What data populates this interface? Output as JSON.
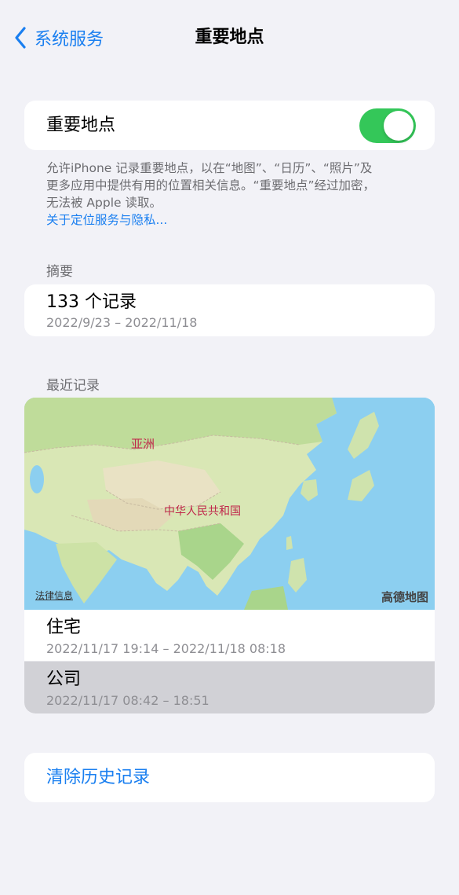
{
  "nav": {
    "back_label": "系统服务",
    "title": "重要地点"
  },
  "toggle": {
    "label": "重要地点",
    "on": true,
    "accent": "#34c759"
  },
  "footnote": {
    "line1": "允许iPhone 记录重要地点，以在“地图”、“日历”、“照片”及",
    "line2": "更多应用中提供有用的位置相关信息。“重要地点”经过加密，",
    "line3": "无法被 Apple 读取。",
    "link": "关于定位服务与隐私..."
  },
  "summary": {
    "header": "摘要",
    "count": "133 个记录",
    "range": "2022/9/23 – 2022/11/18"
  },
  "recent": {
    "header": "最近记录",
    "map": {
      "region_label": "亚洲",
      "country_label": "中华人民共和国",
      "legal": "法律信息",
      "brand": "高德地图"
    },
    "locations": [
      {
        "name": "住宅",
        "time": "2022/11/17 19:14 – 2022/11/18 08:18"
      },
      {
        "name": "公司",
        "time": "2022/11/17 08:42 – 18:51"
      }
    ]
  },
  "clear": {
    "label": "清除历史记录"
  },
  "colors": {
    "link": "#1a7ff0",
    "background": "#f2f2f7"
  }
}
